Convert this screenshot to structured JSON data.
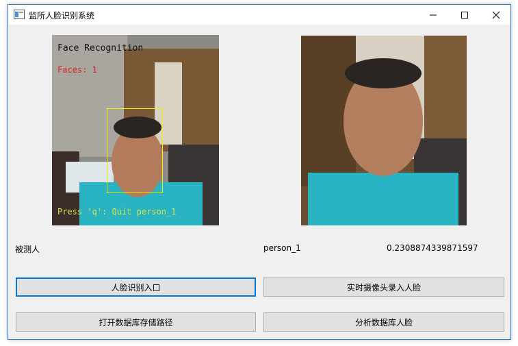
{
  "window": {
    "title": "监所人脸识别系统",
    "controls": {
      "minimize_icon": "minimize-icon",
      "maximize_icon": "maximize-icon",
      "close_icon": "close-icon"
    }
  },
  "left_image": {
    "overlay_title": "Face Recognition",
    "overlay_faces": "Faces: 1",
    "overlay_quit": "Press 'q': Quit person_1"
  },
  "result": {
    "subject_label": "被测人",
    "person_name": "person_1",
    "score": "0.2308874339871597"
  },
  "buttons": {
    "face_recognition": "人脸识别入口",
    "camera_enroll": "实时摄像头录入人脸",
    "open_db_path": "打开数据库存储路径",
    "analyze_db": "分析数据库人脸"
  },
  "colors": {
    "accent": "#0078d7",
    "face_box": "#f3f300",
    "overlay_faces": "#d22222",
    "overlay_quit": "#cfe84a"
  }
}
